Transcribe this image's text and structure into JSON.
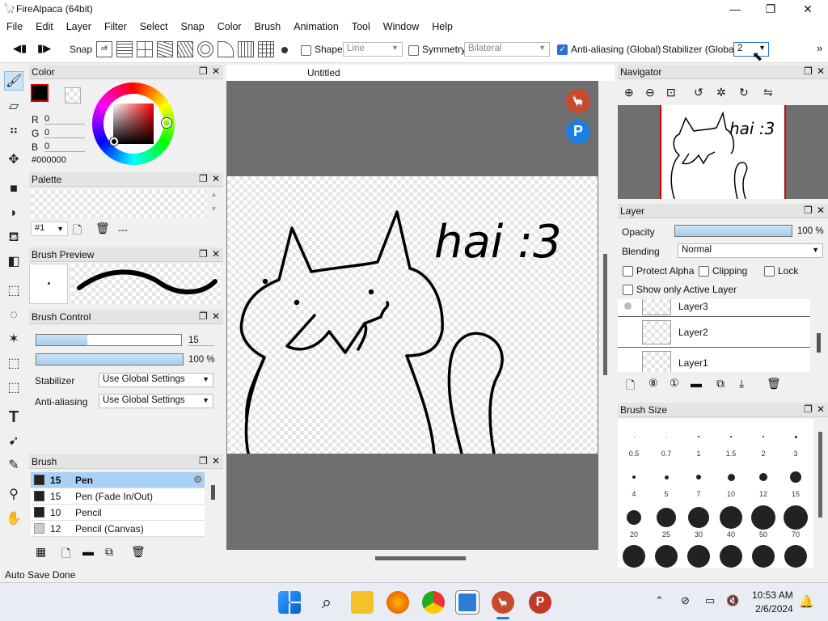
{
  "window": {
    "title": "FireAlpaca (64bit)",
    "min": "—",
    "max": "❐",
    "close": "✕"
  },
  "menu": [
    "File",
    "Edit",
    "Layer",
    "Filter",
    "Select",
    "Snap",
    "Color",
    "Brush",
    "Animation",
    "Tool",
    "Window",
    "Help"
  ],
  "toolbar": {
    "snap": "Snap",
    "shape": "Shape",
    "shape_value": "Line",
    "symmetry": "Symmetry",
    "symmetry_value": "Bilateral",
    "antialias": "Anti-aliasing (Global)",
    "stabilizer": "Stabilizer (Global)",
    "stabilizer_value": "2"
  },
  "color": {
    "title": "Color",
    "r_label": "R",
    "g_label": "G",
    "b_label": "B",
    "r": "0",
    "g": "0",
    "b": "0",
    "hex": "#000000"
  },
  "palette": {
    "title": "Palette",
    "selector": "#1",
    "empty": "---"
  },
  "brush_preview": {
    "title": "Brush Preview"
  },
  "brush_control": {
    "title": "Brush Control",
    "size": "15",
    "opacity": "100 %",
    "size_fraction": 0.35,
    "opacity_fraction": 1.0,
    "stabilizer_label": "Stabilizer",
    "stabilizer_value": "Use Global Settings",
    "antialias_label": "Anti-aliasing",
    "antialias_value": "Use Global Settings"
  },
  "brush": {
    "title": "Brush",
    "items": [
      {
        "size": "15",
        "name": "Pen",
        "selected": true
      },
      {
        "size": "15",
        "name": "Pen (Fade In/Out)"
      },
      {
        "size": "10",
        "name": "Pencil"
      },
      {
        "size": "12",
        "name": "Pencil (Canvas)"
      }
    ]
  },
  "canvas": {
    "tab": "Untitled",
    "text": "hai :3"
  },
  "navigator": {
    "title": "Navigator"
  },
  "layer": {
    "title": "Layer",
    "opacity_label": "Opacity",
    "opacity": "100 %",
    "blending_label": "Blending",
    "blending": "Normal",
    "protect_alpha": "Protect Alpha",
    "clipping": "Clipping",
    "lock": "Lock",
    "show_active": "Show only Active Layer",
    "layers": [
      "Layer3",
      "Layer2",
      "Layer1"
    ]
  },
  "brush_size": {
    "title": "Brush Size",
    "labels": [
      "0.5",
      "0.7",
      "1",
      "1.5",
      "2",
      "3",
      "4",
      "5",
      "7",
      "10",
      "12",
      "15",
      "20",
      "25",
      "30",
      "40",
      "50",
      "70"
    ]
  },
  "status": "Auto Save Done",
  "clock": {
    "time": "10:53 AM",
    "date": "2/6/2024"
  }
}
